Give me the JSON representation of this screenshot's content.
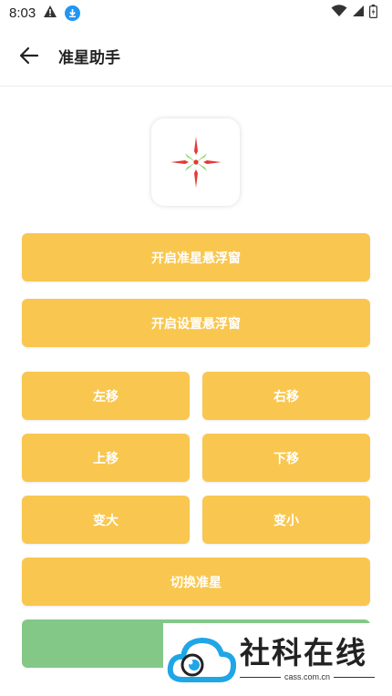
{
  "status_bar": {
    "time": "8:03",
    "icons": [
      "warning-icon",
      "download-icon",
      "wifi-icon",
      "signal-icon",
      "battery-icon"
    ]
  },
  "app_bar": {
    "title": "准星助手",
    "back_icon": "arrow-left-icon"
  },
  "logo": {
    "icon": "crosshair-icon"
  },
  "buttons": {
    "open_crosshair_float": "开启准星悬浮窗",
    "open_settings_float": "开启设置悬浮窗",
    "move_left": "左移",
    "move_right": "右移",
    "move_up": "上移",
    "move_down": "下移",
    "bigger": "变大",
    "smaller": "变小",
    "switch_crosshair": "切换准星"
  },
  "watermark": {
    "text": "社科在线",
    "url": "cass.com.cn"
  },
  "colors": {
    "button": "#f9c74f",
    "green_button": "#84c887",
    "download_badge": "#2196f3",
    "crosshair_red": "#e53935",
    "crosshair_green": "#7ed957"
  }
}
